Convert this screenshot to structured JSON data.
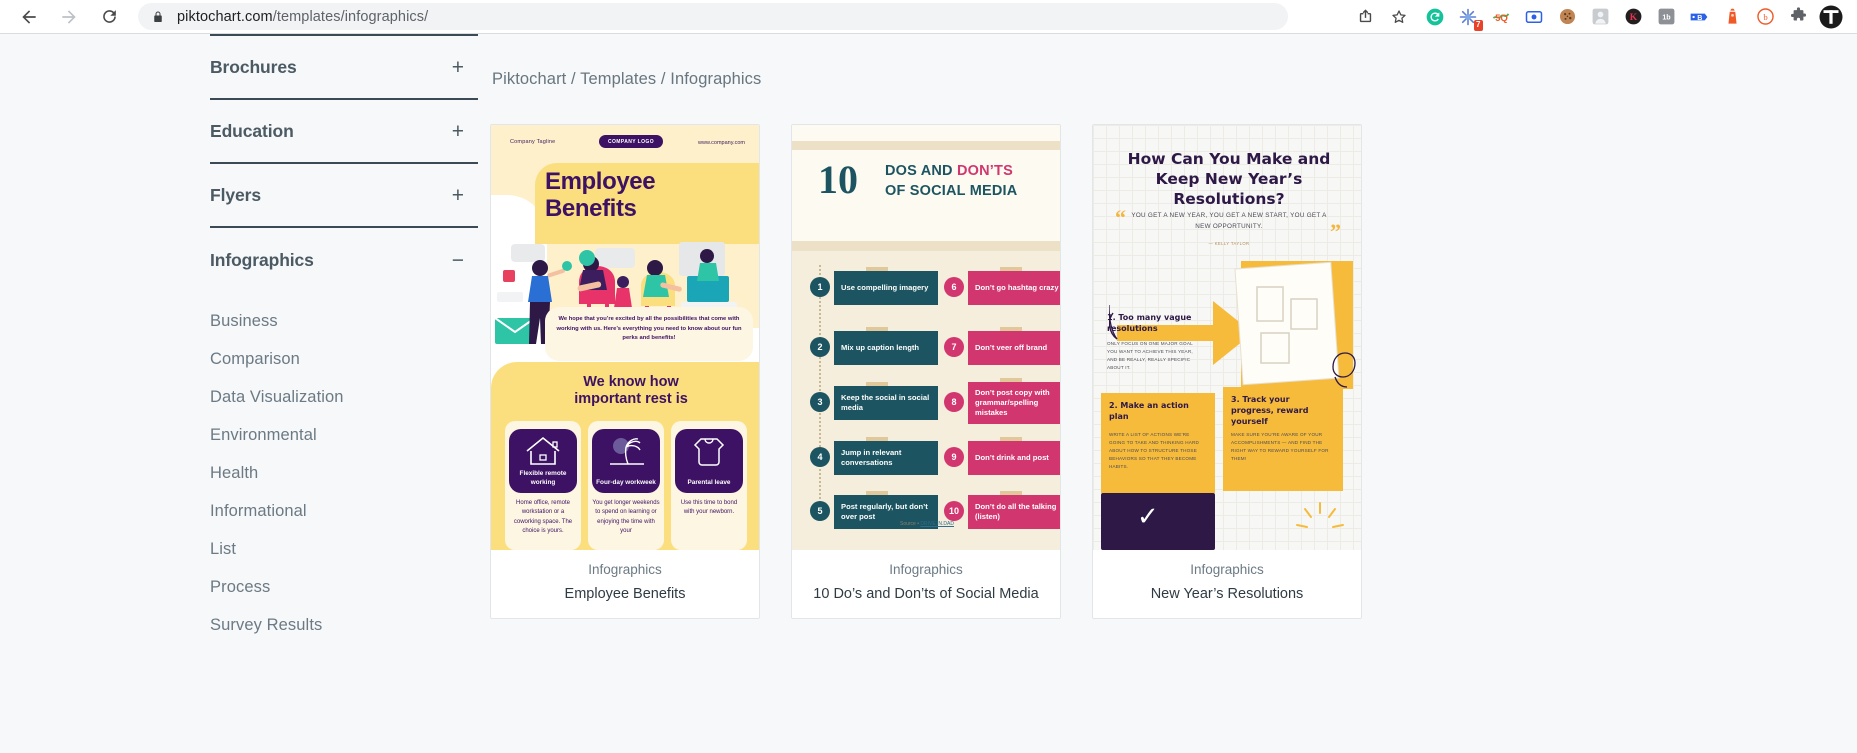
{
  "browser": {
    "back_icon": "back-arrow-icon",
    "forward_icon": "forward-arrow-icon",
    "reload_icon": "reload-icon",
    "lock_icon": "lock-icon",
    "url_host": "piktochart.com",
    "url_path": "/templates/infographics/",
    "share_icon": "share-icon",
    "bookmark_icon": "star-icon",
    "extensions": [
      {
        "name": "grammarly-extension-icon",
        "glyph": "G",
        "color": "#15c39a",
        "badge": ""
      },
      {
        "name": "pinned-extension-icon",
        "glyph": "✳",
        "color": "#4a6fd4",
        "badge": "7"
      },
      {
        "name": "seo-extension-icon",
        "glyph": "SQ",
        "color": "#f05a28",
        "badge": ""
      },
      {
        "name": "screen-recorder-extension-icon",
        "glyph": "◉",
        "color": "#2a61e8",
        "badge": ""
      },
      {
        "name": "cookie-editor-extension-icon",
        "glyph": "🍪",
        "color": "#b5651d",
        "badge": ""
      },
      {
        "name": "profile-extension-icon",
        "glyph": "👤",
        "color": "#9aa0a6",
        "badge": ""
      },
      {
        "name": "keywords-everywhere-extension-icon",
        "glyph": "K",
        "color": "#231f20",
        "badge": ""
      },
      {
        "name": "similarweb-extension-icon",
        "glyph": "1b",
        "color": "#8d9196",
        "badge": ""
      },
      {
        "name": "buzzsumo-extension-icon",
        "glyph": "B",
        "color": "#2a61e8",
        "badge": ""
      },
      {
        "name": "lighthouse-extension-icon",
        "glyph": "⌂",
        "color": "#f05a28",
        "badge": ""
      },
      {
        "name": "hunter-extension-icon",
        "glyph": "h",
        "color": "#f05a28",
        "badge": ""
      },
      {
        "name": "puzzle-extensions-icon",
        "glyph": "🧩",
        "color": "#5f6368",
        "badge": ""
      },
      {
        "name": "profile-avatar-icon",
        "glyph": "T",
        "color": "#202124",
        "badge": ""
      }
    ]
  },
  "sidebar": {
    "accordions": [
      {
        "label": "Brochures",
        "sign": "+",
        "expanded": false
      },
      {
        "label": "Education",
        "sign": "+",
        "expanded": false
      },
      {
        "label": "Flyers",
        "sign": "+",
        "expanded": false
      },
      {
        "label": "Infographics",
        "sign": "−",
        "expanded": true
      }
    ],
    "sub_items": [
      "Business",
      "Comparison",
      "Data Visualization",
      "Environmental",
      "Health",
      "Informational",
      "List",
      "Process",
      "Survey Results"
    ]
  },
  "breadcrumb": {
    "text": "Piktochart / Templates / Infographics",
    "root": "Piktochart",
    "section": "Templates",
    "current": "Infographics"
  },
  "cards": [
    {
      "category": "Infographics",
      "title": "Employee Benefits"
    },
    {
      "category": "Infographics",
      "title": "10 Do’s and Don’ts of Social Media"
    },
    {
      "category": "Infographics",
      "title": "New Year’s Resolutions"
    }
  ],
  "thumb_employee_benefits": {
    "tagline": "Company Tagline",
    "logo": "COMPANY LOGO",
    "website": "www.company.com",
    "heading_line1": "Employee",
    "heading_line2": "Benefits",
    "intro": "We hope that you’re excited by all the possibilities that come with working with us. Here’s everything you need to know about our fun perks and benefits!",
    "section_heading_line1": "We know how",
    "section_heading_line2": "important rest is",
    "benefits": [
      {
        "icon": "house-icon",
        "label": "Flexible remote working",
        "desc": "Home office, remote workstation or a coworking space. The choice is yours."
      },
      {
        "icon": "palm-tree-icon",
        "label": "Four-day workweek",
        "desc": "You get longer weekends to spend on learning or enjoying the time with your"
      },
      {
        "icon": "baby-onesie-icon",
        "label": "Parental leave",
        "desc": "Use this time to bond with your newborn."
      }
    ]
  },
  "thumb_social_media": {
    "big_number": "10",
    "title_part1": "DOS AND ",
    "title_part2": "DON’TS",
    "title_line2": "OF SOCIAL MEDIA",
    "dos": [
      {
        "num": "1",
        "text": "Use compelling imagery"
      },
      {
        "num": "2",
        "text": "Mix up caption length"
      },
      {
        "num": "3",
        "text": "Keep the social in social media"
      },
      {
        "num": "4",
        "text": "Jump in relevant conversations"
      },
      {
        "num": "5",
        "text": "Post regularly, but don’t over post"
      }
    ],
    "donts": [
      {
        "num": "6",
        "text": "Don’t go hashtag crazy"
      },
      {
        "num": "7",
        "text": "Don’t veer off brand"
      },
      {
        "num": "8",
        "text": "Don’t post copy with grammar/spelling mistakes"
      },
      {
        "num": "9",
        "text": "Don’t drink and post"
      },
      {
        "num": "10",
        "text": "Don’t do all the talking (listen)"
      }
    ],
    "source_label": "Source",
    "source_link": "DRIVE.IN.DAD"
  },
  "thumb_new_year": {
    "title": "How Can You Make and Keep New Year’s Resolutions?",
    "quote": "YOU GET A NEW YEAR, YOU GET A NEW START, YOU GET A NEW OPPORTUNITY.",
    "quote_author": "— KELLY TAYLOR",
    "steps": [
      {
        "num": "1.",
        "title": "Too many vague resolutions",
        "body": "ONLY FOCUS ON ONE MAJOR GOAL YOU WANT TO ACHIEVE THIS YEAR, AND BE REALLY, REALLY SPECIFIC ABOUT IT."
      },
      {
        "num": "2.",
        "title": "Make an action plan",
        "body": "WRITE A LIST OF ACTIONS WE’RE GOING TO TAKE AND THINKING HARD ABOUT HOW TO STRUCTURE THOSE BEHAVIORS SO THAT THEY BECOME HABITS."
      },
      {
        "num": "3.",
        "title": "Track your progress, reward yourself",
        "body": "MAKE SURE YOU’RE AWARE OF YOUR ACCOMPLISHMENTS — AND FIND THE RIGHT WAY TO REWARD YOURSELF FOR THEM!"
      }
    ],
    "check_icon": "check-icon"
  },
  "colors": {
    "page_bg": "#f7f8fa",
    "sidebar_text": "#4b5a63",
    "rule": "#3c4a54",
    "teal": "#1c5561",
    "pink": "#d2366f",
    "purple": "#3d1163",
    "yellow": "#fbdf7e",
    "gold": "#f7bb3c"
  }
}
